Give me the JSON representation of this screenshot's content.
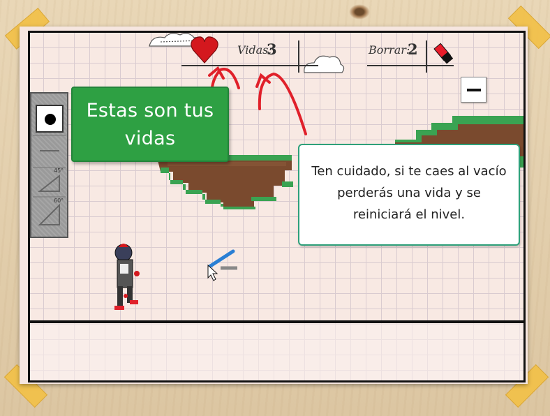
{
  "hud": {
    "lives_label": "Vidas:",
    "lives_value": "3",
    "erase_label": "Borrar:",
    "erase_value": "2",
    "minimize_icon": "minus-icon"
  },
  "toolbar": {
    "tools": [
      "dot-brush-icon",
      "line-tool-icon",
      "ramp-45-tool-icon",
      "ramp-60-tool-icon"
    ],
    "angle_45": "45°",
    "angle_60": "60°"
  },
  "tutorial": {
    "lives_callout": "Estas son tus vidas",
    "warning_callout": "Ten cuidado, si te caes al vacío perderás una vida y se reiniciará el nivel."
  },
  "colors": {
    "callout_green": "#2ea043",
    "arrow_red": "#e0202a",
    "tape_yellow": "#f2c14b",
    "grass_green": "#3aa352",
    "dirt_brown": "#7a4a2e"
  }
}
